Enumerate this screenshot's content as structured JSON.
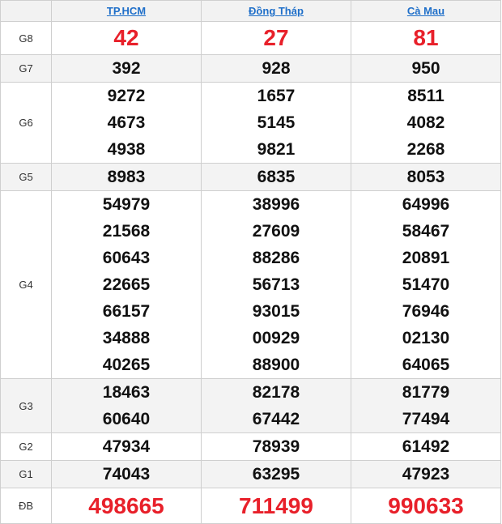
{
  "table": {
    "corner": "",
    "provinces": [
      "TP.HCM",
      "Đồng Tháp",
      "Cà Mau"
    ],
    "accent_color": "#e8202a",
    "link_color": "#1f6fc9",
    "rows": [
      {
        "prize": "G8",
        "values": [
          [
            "42"
          ],
          [
            "27"
          ],
          [
            "81"
          ]
        ]
      },
      {
        "prize": "G7",
        "values": [
          [
            "392"
          ],
          [
            "928"
          ],
          [
            "950"
          ]
        ]
      },
      {
        "prize": "G6",
        "values": [
          [
            "9272",
            "4673",
            "4938"
          ],
          [
            "1657",
            "5145",
            "9821"
          ],
          [
            "8511",
            "4082",
            "2268"
          ]
        ]
      },
      {
        "prize": "G5",
        "values": [
          [
            "8983"
          ],
          [
            "6835"
          ],
          [
            "8053"
          ]
        ]
      },
      {
        "prize": "G4",
        "values": [
          [
            "54979",
            "21568",
            "60643",
            "22665",
            "66157",
            "34888",
            "40265"
          ],
          [
            "38996",
            "27609",
            "88286",
            "56713",
            "93015",
            "00929",
            "88900"
          ],
          [
            "64996",
            "58467",
            "20891",
            "51470",
            "76946",
            "02130",
            "64065"
          ]
        ]
      },
      {
        "prize": "G3",
        "values": [
          [
            "18463",
            "60640"
          ],
          [
            "82178",
            "67442"
          ],
          [
            "81779",
            "77494"
          ]
        ]
      },
      {
        "prize": "G2",
        "values": [
          [
            "47934"
          ],
          [
            "78939"
          ],
          [
            "61492"
          ]
        ]
      },
      {
        "prize": "G1",
        "values": [
          [
            "74043"
          ],
          [
            "63295"
          ],
          [
            "47923"
          ]
        ]
      },
      {
        "prize": "ĐB",
        "values": [
          [
            "498665"
          ],
          [
            "711499"
          ],
          [
            "990633"
          ]
        ]
      }
    ]
  }
}
